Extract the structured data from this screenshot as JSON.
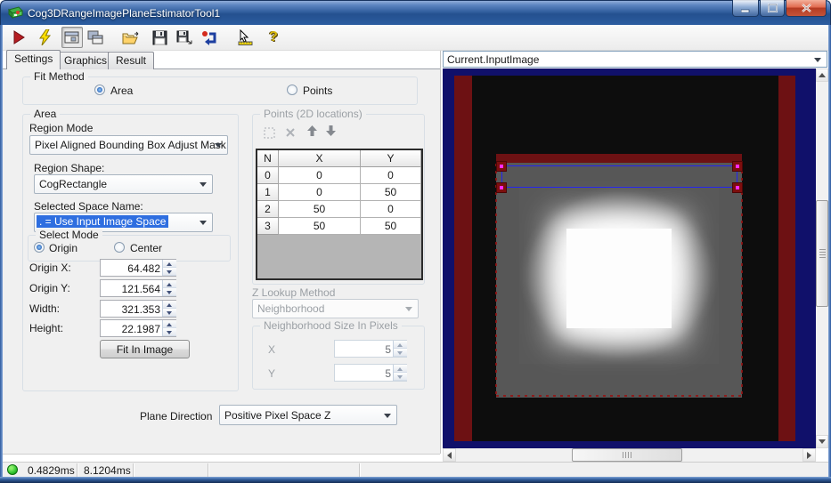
{
  "window": {
    "title": "Cog3DRangeImagePlaneEstimatorTool1",
    "caption_buttons": [
      "minimize",
      "maximize",
      "close"
    ]
  },
  "toolbar": {
    "icons": [
      "run-icon",
      "live-run-icon",
      "show-result-window-icon",
      "float-window-icon",
      "open-file-icon",
      "save-icon",
      "save-as-icon",
      "reset-icon",
      "position-ruler-icon",
      "help-icon"
    ],
    "help_glyph": "?"
  },
  "tabs": [
    {
      "label": "Settings",
      "active": true
    },
    {
      "label": "Graphics",
      "active": false
    },
    {
      "label": "Result",
      "active": false
    }
  ],
  "fit_method": {
    "caption": "Fit Method",
    "area_label": "Area",
    "points_label": "Points",
    "selected": "Area"
  },
  "area_group": {
    "caption": "Area",
    "region_mode_label": "Region Mode",
    "region_mode_value": "Pixel Aligned Bounding Box Adjust Mask",
    "region_shape_label": "Region Shape:",
    "region_shape_value": "CogRectangle",
    "space_name_label": "Selected Space Name:",
    "space_name_value": ". = Use Input Image Space",
    "select_mode_caption": "Select Mode",
    "origin_label": "Origin",
    "center_label": "Center",
    "selected_mode": "Origin",
    "fields": [
      {
        "label": "Origin X:",
        "value": "64.482"
      },
      {
        "label": "Origin Y:",
        "value": "121.564"
      },
      {
        "label": "Width:",
        "value": "321.353"
      },
      {
        "label": "Height:",
        "value": "22.1987"
      }
    ],
    "fit_button": "Fit In Image"
  },
  "points_group": {
    "caption": "Points (2D locations)",
    "toolbar_icons": [
      "add-point-icon",
      "delete-point-icon",
      "move-up-icon",
      "move-down-icon"
    ],
    "enabled": false,
    "table": {
      "headers": [
        "N",
        "X",
        "Y"
      ],
      "rows": [
        [
          "0",
          "0",
          "0"
        ],
        [
          "1",
          "0",
          "50"
        ],
        [
          "2",
          "50",
          "0"
        ],
        [
          "3",
          "50",
          "50"
        ]
      ]
    }
  },
  "z_lookup": {
    "label": "Z Lookup Method",
    "value": "Neighborhood",
    "enabled": false
  },
  "neighborhood": {
    "caption": "Neighborhood Size In Pixels",
    "x_label": "X",
    "x_value": "5",
    "y_label": "Y",
    "y_value": "5",
    "enabled": false
  },
  "plane_direction": {
    "label": "Plane Direction",
    "value": "Positive Pixel Space Z"
  },
  "display": {
    "selector": "Current.InputImage"
  },
  "status": {
    "items": [
      "0.4829ms",
      "8.1204ms"
    ]
  },
  "colors": {
    "titlebar_blue": "#2a56a0",
    "selection_blue": "#2e6ee0",
    "image_background_navy": "#10106a",
    "mask_red": "#6d1113",
    "region_blue": "#2424f0",
    "handle_magenta": "#ff2bff",
    "status_green": "#2fc32f",
    "panel_gray": "#f0f0f0"
  }
}
